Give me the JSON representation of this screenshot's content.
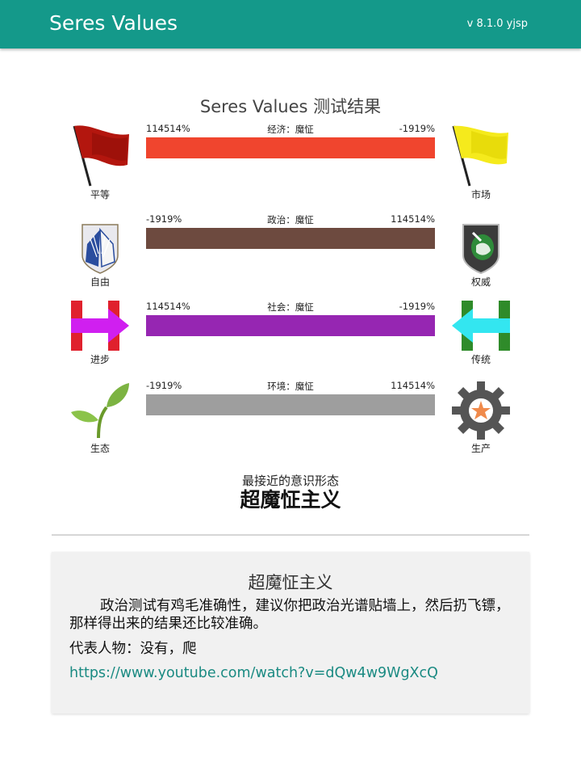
{
  "header": {
    "title": "Seres Values",
    "version": "v 8.1.0 yjsp"
  },
  "result_title": "Seres Values 测试结果",
  "axes": [
    {
      "left_label": "平等",
      "right_label": "市场",
      "left_pct": "114514%",
      "right_pct": "-1919%",
      "axis_text": "经济：魔怔",
      "bar_color": "#f0452e",
      "left_icon": "red-flag-icon",
      "right_icon": "yellow-flag-icon"
    },
    {
      "left_label": "自由",
      "right_label": "权威",
      "left_pct": "-1919%",
      "right_pct": "114514%",
      "axis_text": "政治：魔怔",
      "bar_color": "#6d4a3f",
      "left_icon": "wings-of-freedom-icon",
      "right_icon": "military-police-unicorn-icon"
    },
    {
      "left_label": "进步",
      "right_label": "传统",
      "left_pct": "114514%",
      "right_pct": "-1919%",
      "axis_text": "社会：魔怔",
      "bar_color": "#9626b2",
      "left_icon": "arrow-right-h-icon",
      "right_icon": "arrow-left-h-icon"
    },
    {
      "left_label": "生态",
      "right_label": "生产",
      "left_pct": "-1919%",
      "right_pct": "114514%",
      "axis_text": "环境：魔怔",
      "bar_color": "#9e9e9e",
      "left_icon": "sprout-icon",
      "right_icon": "gear-star-icon"
    }
  ],
  "closest": {
    "label": "最接近的意识形态",
    "value": "超魔怔主义"
  },
  "card": {
    "title": "超魔怔主义",
    "description": "政治测试有鸡毛准确性，建议你把政治光谱贴墙上，然后扔飞镖，那样得出来的结果还比较准确。",
    "representative": "代表人物：没有，爬",
    "link": "https://www.youtube.com/watch?v=dQw4w9WgXcQ"
  }
}
